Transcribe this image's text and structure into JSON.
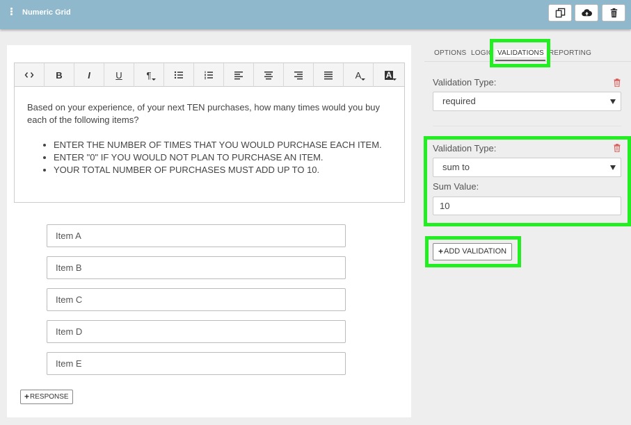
{
  "header": {
    "title": "Numeric Grid",
    "buttons": [
      {
        "name": "copy-button",
        "icon": "copy-icon"
      },
      {
        "name": "save-button",
        "icon": "cloud-upload-icon"
      },
      {
        "name": "delete-button",
        "icon": "trash-icon"
      }
    ]
  },
  "editor": {
    "toolbar": [
      "code",
      "bold",
      "italic",
      "underline",
      "paragraph",
      "bullet-list",
      "numbered-list",
      "align-left",
      "align-center",
      "align-right",
      "justify",
      "font-color",
      "background-color"
    ],
    "toolbar_labels": {
      "bold": "B",
      "italic": "I",
      "underline": "U",
      "paragraph": "¶",
      "font_color": "A",
      "background_color": "A"
    },
    "intro": "Based on your experience, of your next TEN purchases, how many times would you buy each of the following items?",
    "bullets": [
      "ENTER THE NUMBER OF TIMES THAT YOU WOULD PURCHASE EACH ITEM.",
      "ENTER \"0\" IF YOU WOULD NOT PLAN TO PURCHASE AN ITEM.",
      "YOUR TOTAL NUMBER OF PURCHASES MUST ADD UP TO 10."
    ]
  },
  "items": [
    "Item A",
    "Item B",
    "Item C",
    "Item D",
    "Item E"
  ],
  "add_response_label": "RESPONSE",
  "tabs": [
    "OPTIONS",
    "LOGIC",
    "VALIDATIONS",
    "REPORTING"
  ],
  "active_tab": "VALIDATIONS",
  "validations": [
    {
      "type_label": "Validation Type:",
      "type_value": "required"
    },
    {
      "type_label": "Validation Type:",
      "type_value": "sum to",
      "sum_label": "Sum Value:",
      "sum_value": "10"
    }
  ],
  "add_validation_label": "ADD VALIDATION",
  "colors": {
    "header": "#8fb8cc",
    "highlight": "#22ee22",
    "trash": "#d9534f"
  }
}
